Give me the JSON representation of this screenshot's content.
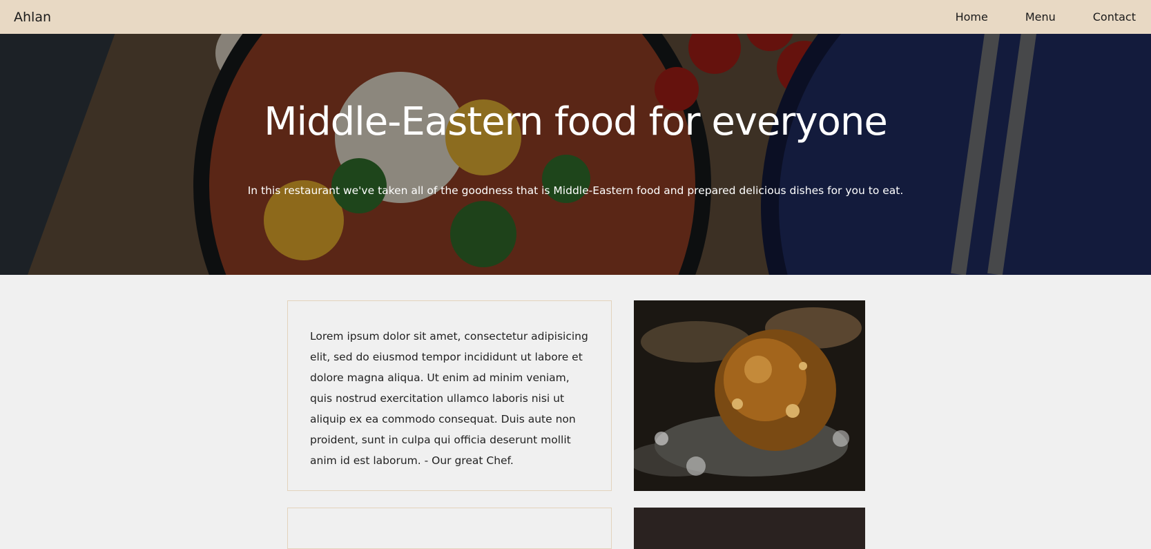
{
  "nav": {
    "brand": "Ahlan",
    "links": [
      "Home",
      "Menu",
      "Contact"
    ]
  },
  "hero": {
    "title": "Middle-Eastern food for everyone",
    "subtitle": "In this restaurant we've taken all of the goodness that is Middle-Eastern food and prepared delicious dishes for you to eat."
  },
  "intro": {
    "text": "Lorem ipsum dolor sit amet, consectetur adipisicing elit, sed do eiusmod tempor incididunt ut labore et dolore magna aliqua. Ut enim ad minim veniam, quis nostrud exercitation ullamco laboris nisi ut aliquip ex ea commodo consequat. Duis aute non proident, sunt in culpa qui officia deserunt mollit anim id est laborum. - Our great Chef."
  },
  "colors": {
    "navbar": "#e8d9c4",
    "page_bg": "#f0f0f0",
    "card_border": "#e3d3bc"
  }
}
